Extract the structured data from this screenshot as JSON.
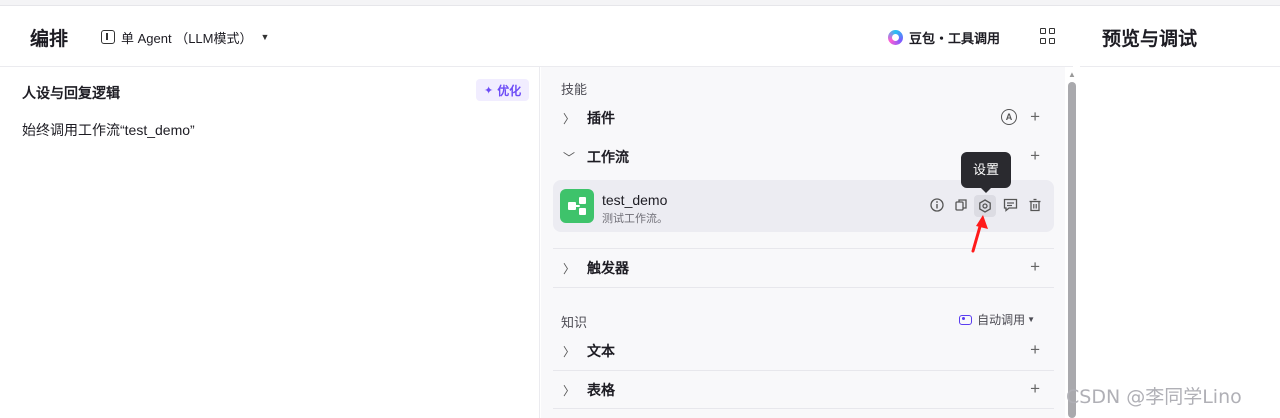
{
  "header": {
    "title": "编排",
    "mode": "单 Agent （LLM模式）",
    "model": "豆包・工具调用",
    "preview_title": "预览与调试"
  },
  "persona": {
    "title": "人设与回复逻辑",
    "optimize_label": "优化",
    "content": "始终调用工作流“test_demo”"
  },
  "skills": {
    "section_title": "技能",
    "plugin_label": "插件",
    "workflow_label": "工作流",
    "trigger_label": "触发器",
    "workflow_item": {
      "name": "test_demo",
      "description": "测试工作流。"
    },
    "tooltip": "设置"
  },
  "knowledge": {
    "section_title": "知识",
    "auto_call_label": "自动调用",
    "text_label": "文本",
    "table_label": "表格"
  },
  "watermark": "CSDN @李同学Lino",
  "colors": {
    "accent": "#6d4cf6",
    "workflow_icon": "#3ec36b",
    "arrow": "#ff1a1a"
  }
}
